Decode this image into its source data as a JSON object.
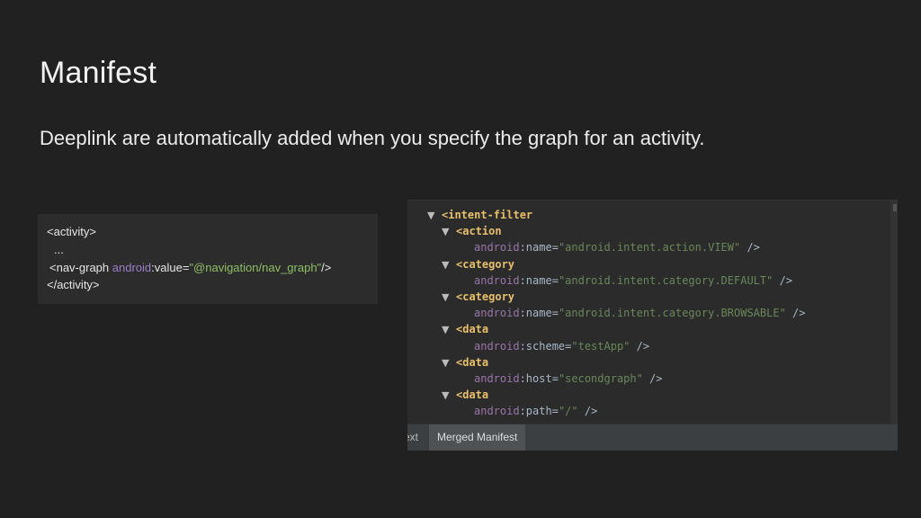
{
  "slide": {
    "title": "Manifest",
    "subtitle": "Deeplink are automatically added when you specify the graph for an activity."
  },
  "code_snippet": {
    "line1": "<activity>",
    "line2": "...",
    "line3_open": "<nav-graph ",
    "line3_ns": "android",
    "line3_attr": ":value=",
    "line3_value": "\"@navigation/nav_graph\"",
    "line3_close": "/>",
    "line4": "</activity>"
  },
  "ide": {
    "rows": [
      {
        "tri": "▼",
        "tag": "<intent-filter"
      },
      {
        "tri": "▼",
        "tag": "<action"
      },
      {
        "ns": "android",
        "attr": ":name=",
        "value": "\"android.intent.action.VIEW\"",
        "end": " />"
      },
      {
        "tri": "▼",
        "tag": "<category"
      },
      {
        "ns": "android",
        "attr": ":name=",
        "value": "\"android.intent.category.DEFAULT\"",
        "end": " />"
      },
      {
        "tri": "▼",
        "tag": "<category"
      },
      {
        "ns": "android",
        "attr": ":name=",
        "value": "\"android.intent.category.BROWSABLE\"",
        "end": " />"
      },
      {
        "tri": "▼",
        "tag": "<data"
      },
      {
        "ns": "android",
        "attr": ":scheme=",
        "value": "\"testApp\"",
        "end": " />"
      },
      {
        "tri": "▼",
        "tag": "<data"
      },
      {
        "ns": "android",
        "attr": ":host=",
        "value": "\"secondgraph\"",
        "end": " />"
      },
      {
        "tri": "▼",
        "tag": "<data"
      },
      {
        "ns": "android",
        "attr": ":path=",
        "value": "\"/\"",
        "end": " />"
      }
    ],
    "tabs": {
      "text_tab": "ext",
      "merged_tab": "Merged Manifest"
    }
  }
}
